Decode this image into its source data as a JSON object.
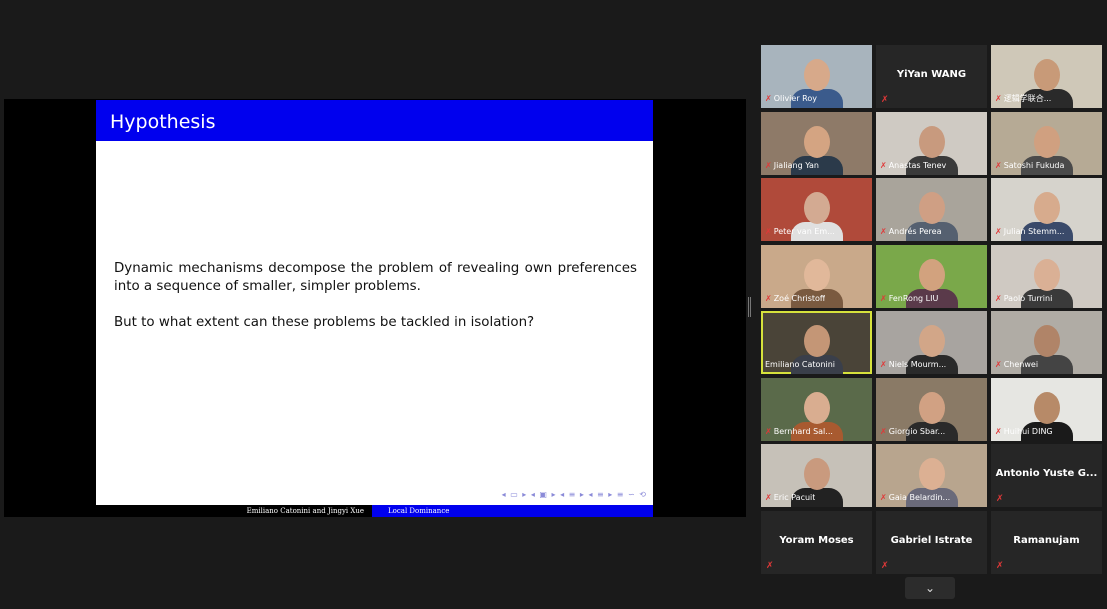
{
  "slide": {
    "title": "Hypothesis",
    "paragraph1": "Dynamic mechanisms decompose the problem of revealing own preferences into a sequence of smaller, simpler problems.",
    "paragraph2": "But to what extent can these problems be tackled in isolation?",
    "footer_authors": "Emiliano Catonini and Jingyi Xue",
    "footer_title": "Local Dominance",
    "nav_symbols": "◂ ▭ ▸ ◂ ▣ ▸ ◂ ≡ ▸ ◂ ≡ ▸ ≡ ∽ ⟲"
  },
  "participants": [
    {
      "name": "Olivier Roy",
      "muted": true,
      "video": true,
      "bg": "#a8b4bd",
      "skin": "#d7a98a",
      "shirt": "#3b5b8c"
    },
    {
      "name": "YiYan WANG",
      "muted": true,
      "video": false
    },
    {
      "name": "逻辑学联合...",
      "muted": true,
      "video": true,
      "bg": "#cfc8b8",
      "skin": "#c89a78",
      "shirt": "#2a2a2a"
    },
    {
      "name": "Jialiang Yan",
      "muted": true,
      "video": true,
      "bg": "#8e7a68",
      "skin": "#d4a482",
      "shirt": "#2b3a4a"
    },
    {
      "name": "Anastas Tenev",
      "muted": true,
      "video": true,
      "bg": "#cfcac3",
      "skin": "#c89a7e",
      "shirt": "#3a3a3a"
    },
    {
      "name": "Satoshi Fukuda",
      "muted": true,
      "video": true,
      "bg": "#b6aa95",
      "skin": "#d0a080",
      "shirt": "#4a4a4a"
    },
    {
      "name": "Peter van Em...",
      "muted": true,
      "video": true,
      "bg": "#b04a3a",
      "skin": "#d3aa92",
      "shirt": "#e0e0e0"
    },
    {
      "name": "Andrés Perea",
      "muted": true,
      "video": true,
      "bg": "#a9a49b",
      "skin": "#cf9f84",
      "shirt": "#556070"
    },
    {
      "name": "Julian Stemm...",
      "muted": true,
      "video": true,
      "bg": "#d6d3cc",
      "skin": "#d7ab8d",
      "shirt": "#3a4a6a"
    },
    {
      "name": "Zoé Christoff",
      "muted": true,
      "video": true,
      "bg": "#c9a98a",
      "skin": "#e1b89a",
      "shirt": "#7a5a40"
    },
    {
      "name": "FenRong LIU",
      "muted": true,
      "video": true,
      "bg": "#7aa84a",
      "skin": "#d2a27e",
      "shirt": "#5a3a4a"
    },
    {
      "name": "Paolo Turrini",
      "muted": true,
      "video": true,
      "bg": "#cfc9c2",
      "skin": "#dab095",
      "shirt": "#3a3a3a"
    },
    {
      "name": "Emiliano Catonini",
      "muted": false,
      "video": true,
      "active": true,
      "bg": "#4a4438",
      "skin": "#c49676",
      "shirt": "#3a3f4a"
    },
    {
      "name": "Niels Mourm...",
      "muted": true,
      "video": true,
      "bg": "#a8a4a0",
      "skin": "#d2a688",
      "shirt": "#2a2a2a"
    },
    {
      "name": "Chenwei",
      "muted": true,
      "video": true,
      "bg": "#b0aca5",
      "skin": "#b08468",
      "shirt": "#444"
    },
    {
      "name": "Bernhard Sal...",
      "muted": true,
      "video": true,
      "bg": "#5a6a4a",
      "skin": "#d9ad90",
      "shirt": "#a85a30"
    },
    {
      "name": "Giorgio Sbar...",
      "muted": true,
      "video": true,
      "bg": "#8a7a66",
      "skin": "#d1a183",
      "shirt": "#2a2a2a"
    },
    {
      "name": "Huihui DING",
      "muted": true,
      "video": true,
      "bg": "#e6e6e2",
      "skin": "#b78a68",
      "shirt": "#1a1a1a"
    },
    {
      "name": "Eric Pacuit",
      "muted": true,
      "video": true,
      "bg": "#c6c1b8",
      "skin": "#c99a7e",
      "shirt": "#222"
    },
    {
      "name": "Gaia Belardin...",
      "muted": true,
      "video": true,
      "bg": "#b8a58e",
      "skin": "#dcb093",
      "shirt": "#6a6a7a"
    },
    {
      "name": "Antonio Yuste G...",
      "muted": true,
      "video": false
    },
    {
      "name": "Yoram Moses",
      "muted": true,
      "video": false
    },
    {
      "name": "Gabriel Istrate",
      "muted": true,
      "video": false
    },
    {
      "name": "Ramanujam",
      "muted": true,
      "video": false
    }
  ],
  "controls": {
    "scroll_down_icon": "⌄"
  },
  "colors": {
    "beamer_blue": "#0000ee",
    "muted_red": "#e03838",
    "active_speaker": "#d6e23c"
  }
}
